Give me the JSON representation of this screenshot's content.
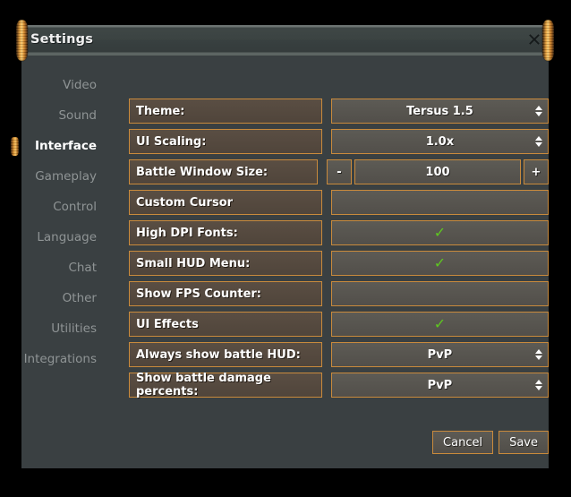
{
  "window": {
    "title": "Settings",
    "close_icon": "close-x-icon"
  },
  "sidebar": {
    "items": [
      {
        "label": "Video",
        "active": false
      },
      {
        "label": "Sound",
        "active": false
      },
      {
        "label": "Interface",
        "active": true
      },
      {
        "label": "Gameplay",
        "active": false
      },
      {
        "label": "Control",
        "active": false
      },
      {
        "label": "Language",
        "active": false
      },
      {
        "label": "Chat",
        "active": false
      },
      {
        "label": "Other",
        "active": false
      },
      {
        "label": "Utilities",
        "active": false
      },
      {
        "label": "Integrations",
        "active": false
      }
    ]
  },
  "settings": {
    "rows": [
      {
        "label": "Theme:",
        "type": "select",
        "value": "Tersus 1.5"
      },
      {
        "label": "UI Scaling:",
        "type": "select",
        "value": "1.0x"
      },
      {
        "label": "Battle Window Size:",
        "type": "stepper",
        "value": "100",
        "decrement": "-",
        "increment": "+"
      },
      {
        "label": "Custom Cursor",
        "type": "checkbox",
        "checked": false
      },
      {
        "label": "High DPI Fonts:",
        "type": "checkbox",
        "checked": true
      },
      {
        "label": "Small HUD Menu:",
        "type": "checkbox",
        "checked": true
      },
      {
        "label": "Show FPS Counter:",
        "type": "checkbox",
        "checked": false
      },
      {
        "label": "UI Effects",
        "type": "checkbox",
        "checked": true
      },
      {
        "label": "Always show battle HUD:",
        "type": "select",
        "value": "PvP"
      },
      {
        "label": "Show battle damage percents:",
        "type": "select",
        "value": "PvP"
      }
    ],
    "check_glyph": "✓"
  },
  "footer": {
    "cancel_label": "Cancel",
    "save_label": "Save"
  },
  "colors": {
    "window_bg": "#3a4042",
    "titlebar_bg": "#3b4342",
    "border_accent": "#c98a3c",
    "label_fill": "#554a40",
    "value_fill": "#575550",
    "check_green": "#5ec620",
    "text_active": "#ffffff",
    "text_inactive": "#8f9495"
  }
}
